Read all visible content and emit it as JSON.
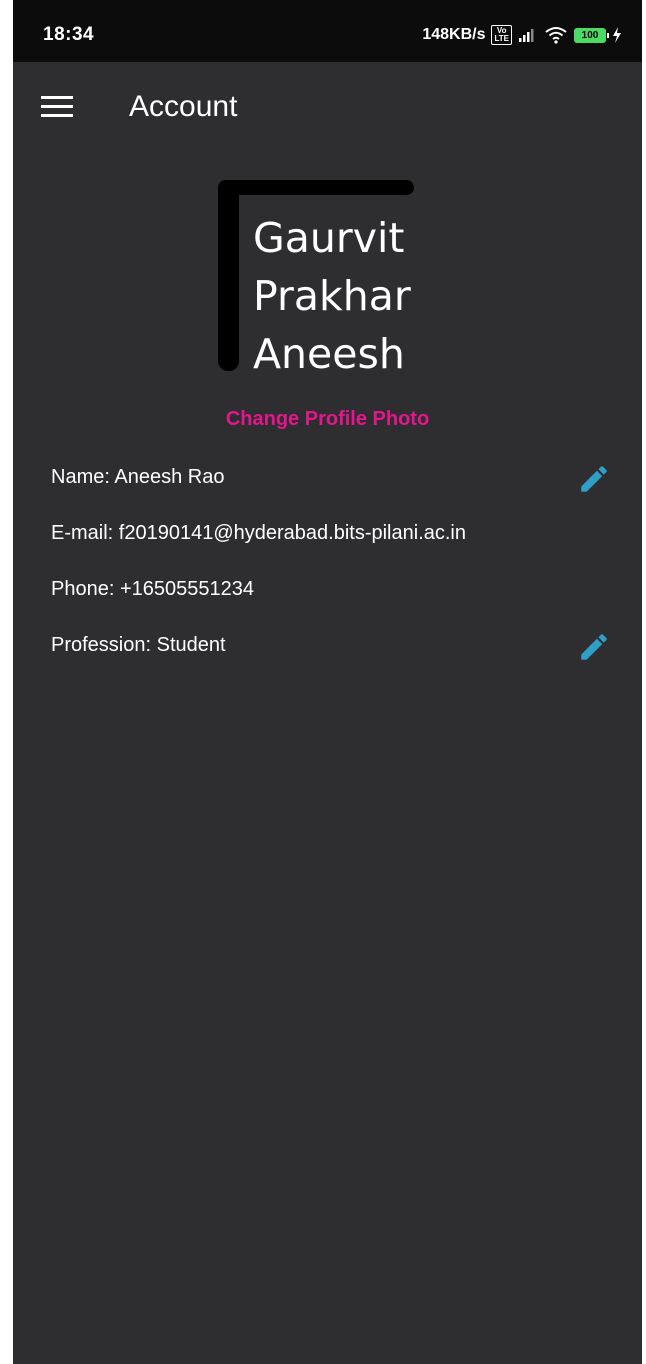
{
  "status_bar": {
    "time": "18:34",
    "net_speed": "148KB/s",
    "volte": "Vo LTE",
    "battery": "100"
  },
  "app_bar": {
    "title": "Account"
  },
  "profile": {
    "logo_lines": [
      "Gaurvit",
      "Prakhar",
      "Aneesh"
    ],
    "change_photo_label": "Change Profile Photo"
  },
  "fields": {
    "name": "Name: Aneesh Rao",
    "email": "E-mail: f20190141@hyderabad.bits-pilani.ac.in",
    "phone": "Phone: +16505551234",
    "profession": "Profession: Student"
  },
  "colors": {
    "background": "#2e2e30",
    "accent": "#e3168b",
    "edit_icon": "#2f9fc8"
  }
}
